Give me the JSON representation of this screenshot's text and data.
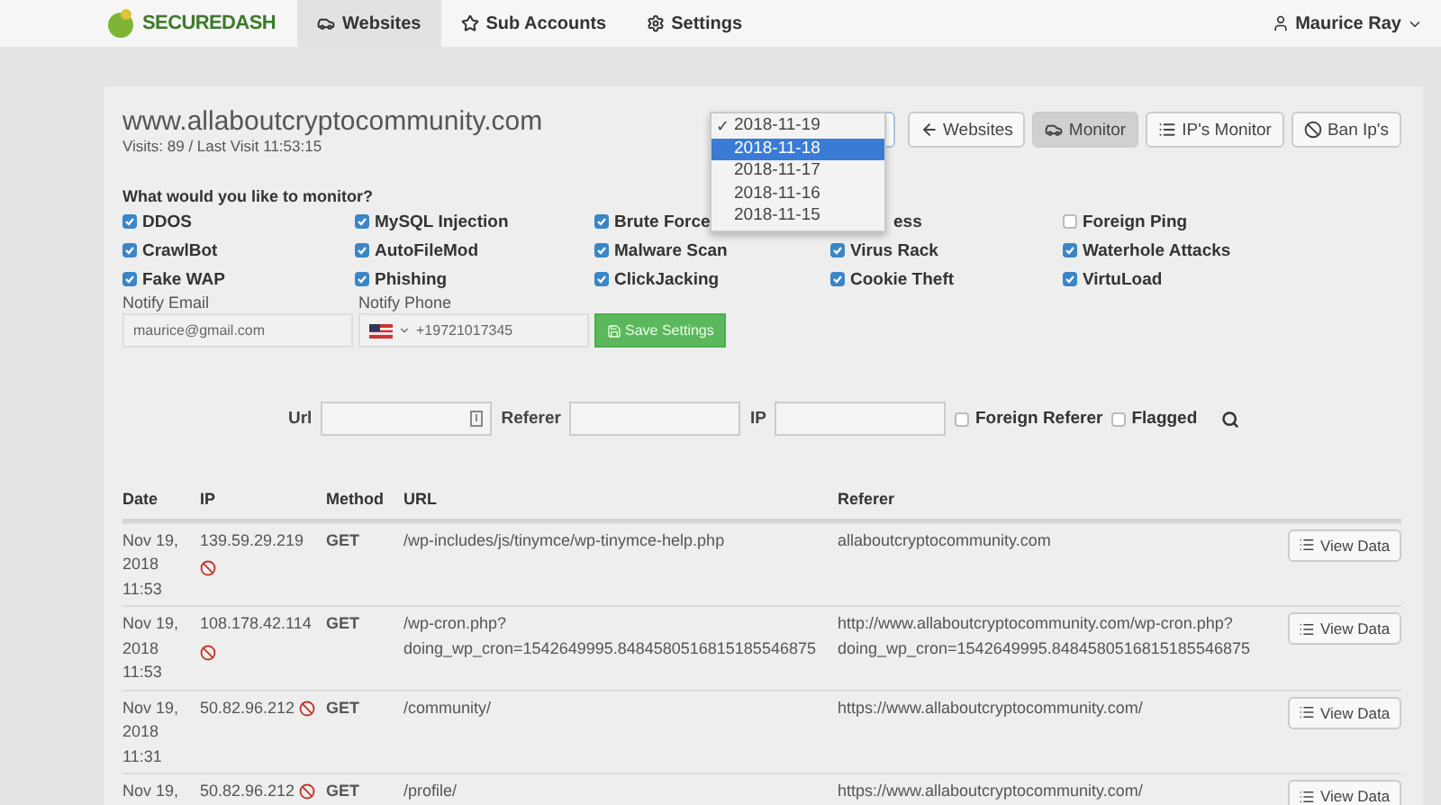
{
  "nav": {
    "brand": "SECUREDASH",
    "tabs": [
      {
        "label": "Websites",
        "selected": true
      },
      {
        "label": "Sub Accounts",
        "selected": false
      },
      {
        "label": "Settings",
        "selected": false
      }
    ],
    "user": "Maurice Ray"
  },
  "site": {
    "title": "www.allaboutcryptocommunity.com",
    "subtitle": "Visits: 89 / Last Visit 11:53:15"
  },
  "date_select": {
    "expanded": true,
    "check_mark": "✓",
    "options": [
      {
        "label": "2018-11-19",
        "selected": true,
        "highlighted": false
      },
      {
        "label": "2018-11-18",
        "selected": false,
        "highlighted": true
      },
      {
        "label": "2018-11-17",
        "selected": false,
        "highlighted": false
      },
      {
        "label": "2018-11-16",
        "selected": false,
        "highlighted": false
      },
      {
        "label": "2018-11-15",
        "selected": false,
        "highlighted": false
      }
    ]
  },
  "toolbar": [
    {
      "label": "Websites",
      "selected": false
    },
    {
      "label": "Monitor",
      "selected": true
    },
    {
      "label": "IP's Monitor",
      "selected": false
    },
    {
      "label": "Ban Ip's",
      "selected": false
    }
  ],
  "monitor": {
    "question": "What would you like to monitor?",
    "options": [
      {
        "label": "DDOS",
        "checked": true
      },
      {
        "label": "MySQL Injection",
        "checked": true
      },
      {
        "label": "Brute Force",
        "checked": true
      },
      {
        "label": "ess"
      },
      {
        "label": "Foreign Ping",
        "checked": false
      },
      {
        "label": "CrawlBot",
        "checked": true
      },
      {
        "label": "AutoFileMod",
        "checked": true
      },
      {
        "label": "Malware Scan",
        "checked": true
      },
      {
        "label": "Virus Rack",
        "checked": true
      },
      {
        "label": "Waterhole Attacks",
        "checked": true
      },
      {
        "label": "Fake WAP",
        "checked": true
      },
      {
        "label": "Phishing",
        "checked": true
      },
      {
        "label": "ClickJacking",
        "checked": true
      },
      {
        "label": "Cookie Theft",
        "checked": true
      },
      {
        "label": "VirtuLoad",
        "checked": true
      }
    ]
  },
  "notify": {
    "email_label": "Notify Email",
    "email": "maurice@gmail.com",
    "phone_label": "Notify Phone",
    "phone": "+19721017345",
    "save": "Save Settings"
  },
  "filters": {
    "url_label": "Url",
    "referer_label": "Referer",
    "ip_label": "IP",
    "checks": [
      {
        "label": "Foreign Referer",
        "checked": false
      },
      {
        "label": "Flagged",
        "checked": false
      }
    ]
  },
  "table": {
    "columns": [
      "Date",
      "IP",
      "Method",
      "URL",
      "Referer"
    ],
    "rows": [
      {
        "date": [
          "Nov 19,",
          "2018",
          "11:53"
        ],
        "ip": "139.59.29.219",
        "banned": true,
        "ban_inline": false,
        "method": "GET",
        "url": "/wp-includes/js/tinymce/wp-tinymce-help.php",
        "referer": "allaboutcryptocommunity.com",
        "action": "View Data"
      },
      {
        "date": [
          "Nov 19,",
          "2018",
          "11:53"
        ],
        "ip": "108.178.42.114",
        "banned": true,
        "ban_inline": false,
        "method": "GET",
        "url": "/wp-cron.php?\ndoing_wp_cron=1542649995.8484580516815185546875",
        "referer": "http://www.allaboutcryptocommunity.com/wp-cron.php?\ndoing_wp_cron=1542649995.8484580516815185546875",
        "action": "View Data"
      },
      {
        "date": [
          "Nov 19,",
          "2018",
          "11:31"
        ],
        "ip": "50.82.96.212",
        "banned": true,
        "ban_inline": true,
        "method": "GET",
        "url": "/community/",
        "referer": "https://www.allaboutcryptocommunity.com/",
        "action": "View Data"
      },
      {
        "date": [
          "Nov 19,"
        ],
        "ip": "50.82.96.212",
        "banned": true,
        "ban_inline": true,
        "method": "GET",
        "url": "/profile/",
        "referer": "https://www.allaboutcryptocommunity.com/",
        "action": "View Data"
      }
    ]
  }
}
